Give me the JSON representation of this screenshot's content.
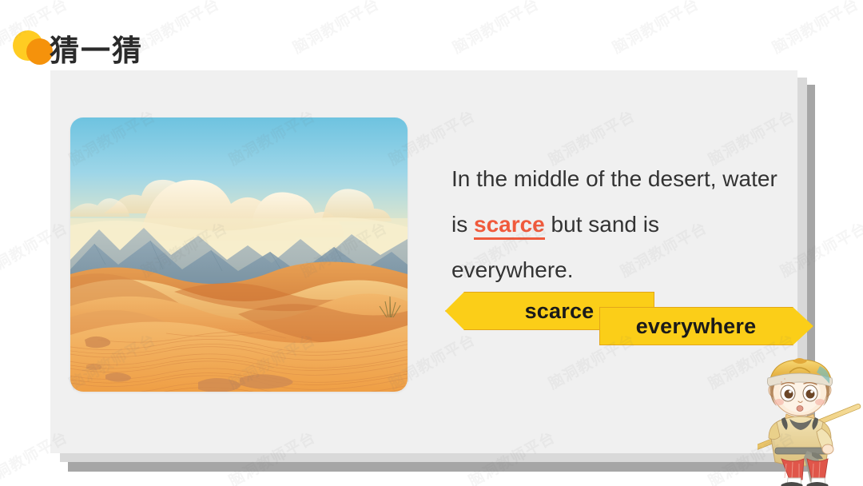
{
  "header": {
    "title": "猜一猜",
    "logo": {
      "back_color": "#FFCC22",
      "front_color": "#F5920B"
    }
  },
  "watermark": {
    "text": "脑洞教师平台"
  },
  "card": {
    "main_color": "#f0f0f0",
    "mid_color": "#d9d9d9",
    "back_color": "#a6a6a6"
  },
  "illustration": {
    "alt": "desert-dunes-with-mountains-and-clouds",
    "sky_top_color": "#7ec8e3",
    "sky_bottom_color": "#f7eec4",
    "cloud_color": "#f6ead0",
    "mountain_color": "#7d94a6",
    "sand_light_color": "#f3c178",
    "sand_mid_color": "#e99c4e",
    "sand_dark_color": "#cf7434"
  },
  "sentence": {
    "part1": "In the middle of the desert, water is ",
    "keyword": "scarce",
    "part2": " but sand is everywhere.",
    "keyword_color": "#F05A3C",
    "text_color": "#333333"
  },
  "answers": [
    {
      "label": "scarce",
      "shape": "left-arrow-banner",
      "color": "#FBCE18"
    },
    {
      "label": "everywhere",
      "shape": "right-arrow-banner",
      "color": "#FBCE18"
    }
  ],
  "mascot": {
    "name": "monkey-king-character",
    "cap_color": "#f0c23e",
    "robe_color": "#e9d08a",
    "pants_color": "#e0564a",
    "staff_color": "#ecc96a"
  }
}
